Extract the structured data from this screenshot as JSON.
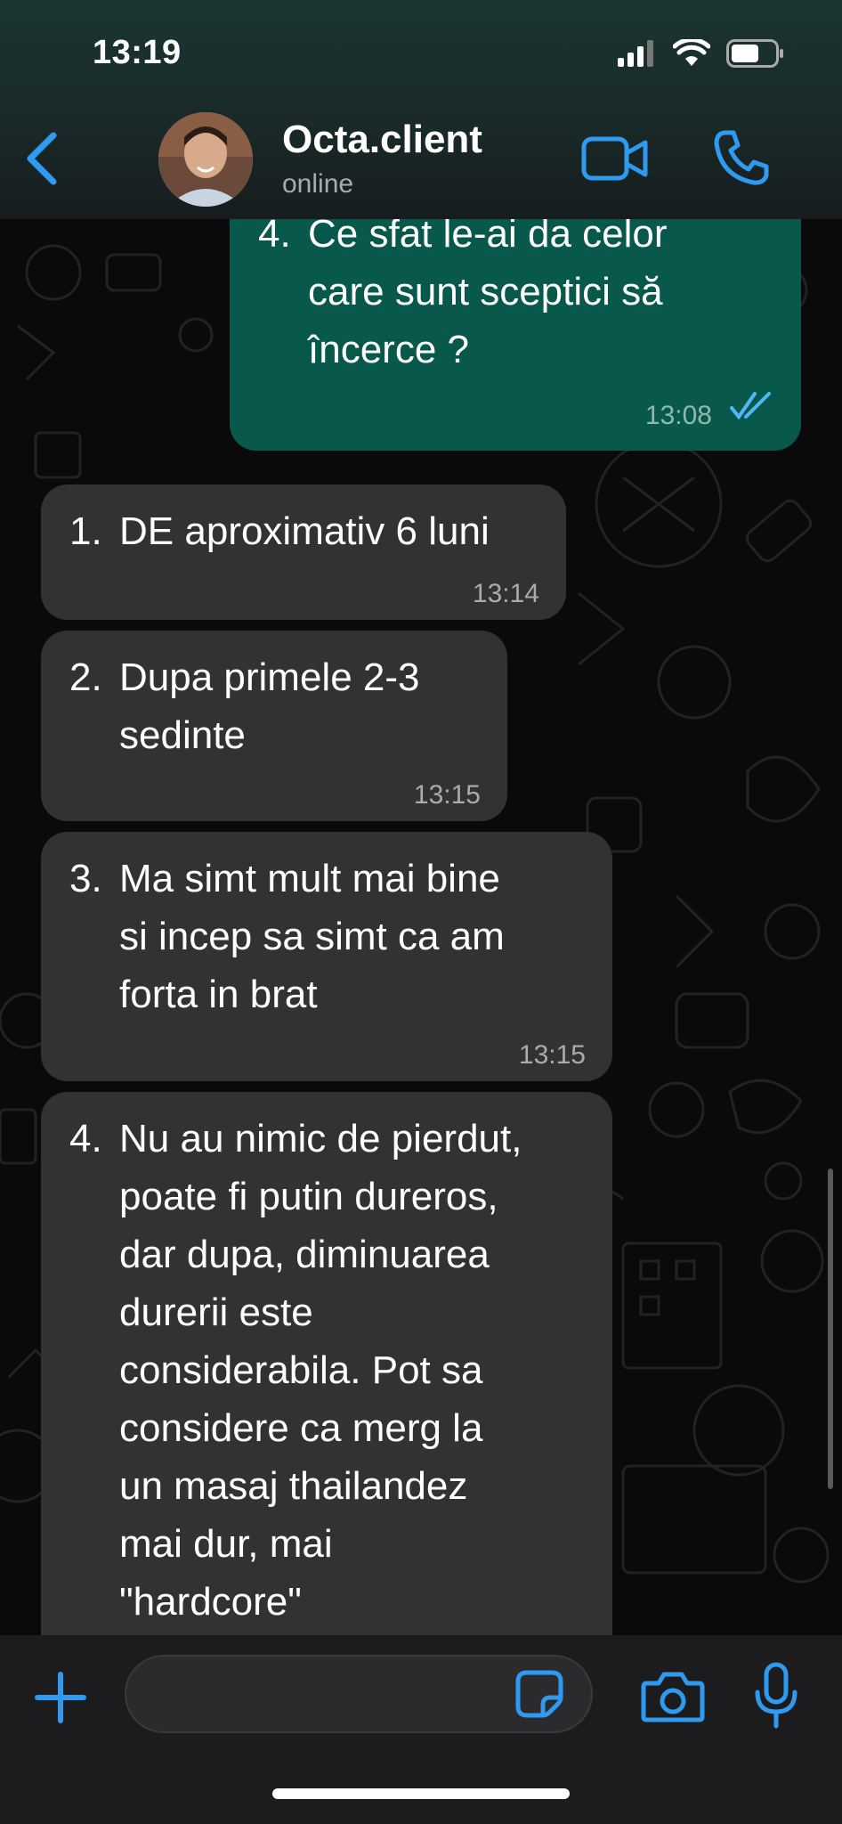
{
  "status_bar": {
    "time": "13:19"
  },
  "header": {
    "contact_name": "Octa.client",
    "contact_status": "online"
  },
  "messages": [
    {
      "direction": "outgoing",
      "number": "4.",
      "lines": [
        "Ce sfat le-ai da celor",
        "care sunt sceptici să",
        "încerce ?"
      ],
      "time": "13:08",
      "read": true
    },
    {
      "direction": "incoming",
      "number": "1.",
      "lines": [
        "DE aproximativ 6 luni"
      ],
      "time": "13:14"
    },
    {
      "direction": "incoming",
      "number": "2.",
      "lines": [
        "Dupa primele 2-3",
        "sedinte"
      ],
      "time": "13:15"
    },
    {
      "direction": "incoming",
      "number": "3.",
      "lines": [
        "Ma simt mult mai bine",
        "si incep sa simt ca am",
        "forta in brat"
      ],
      "time": "13:15"
    },
    {
      "direction": "incoming",
      "number": "4.",
      "lines": [
        "Nu au nimic de pierdut,",
        "poate fi putin dureros,",
        "dar dupa, diminuarea",
        "durerii este",
        "considerabila. Pot sa",
        "considere ca merg la",
        "un masaj thailandez",
        "mai dur, mai",
        "\"hardcore\""
      ],
      "time": ""
    }
  ],
  "composer": {
    "value": "",
    "placeholder": ""
  },
  "colors": {
    "accent": "#2f9bf0",
    "outgoing_bubble": "#08594c",
    "incoming_bubble": "#323234"
  },
  "icons": [
    "back-chevron-icon",
    "video-call-icon",
    "phone-icon",
    "plus-icon",
    "sticker-icon",
    "camera-icon",
    "microphone-icon",
    "read-ticks-icon"
  ]
}
